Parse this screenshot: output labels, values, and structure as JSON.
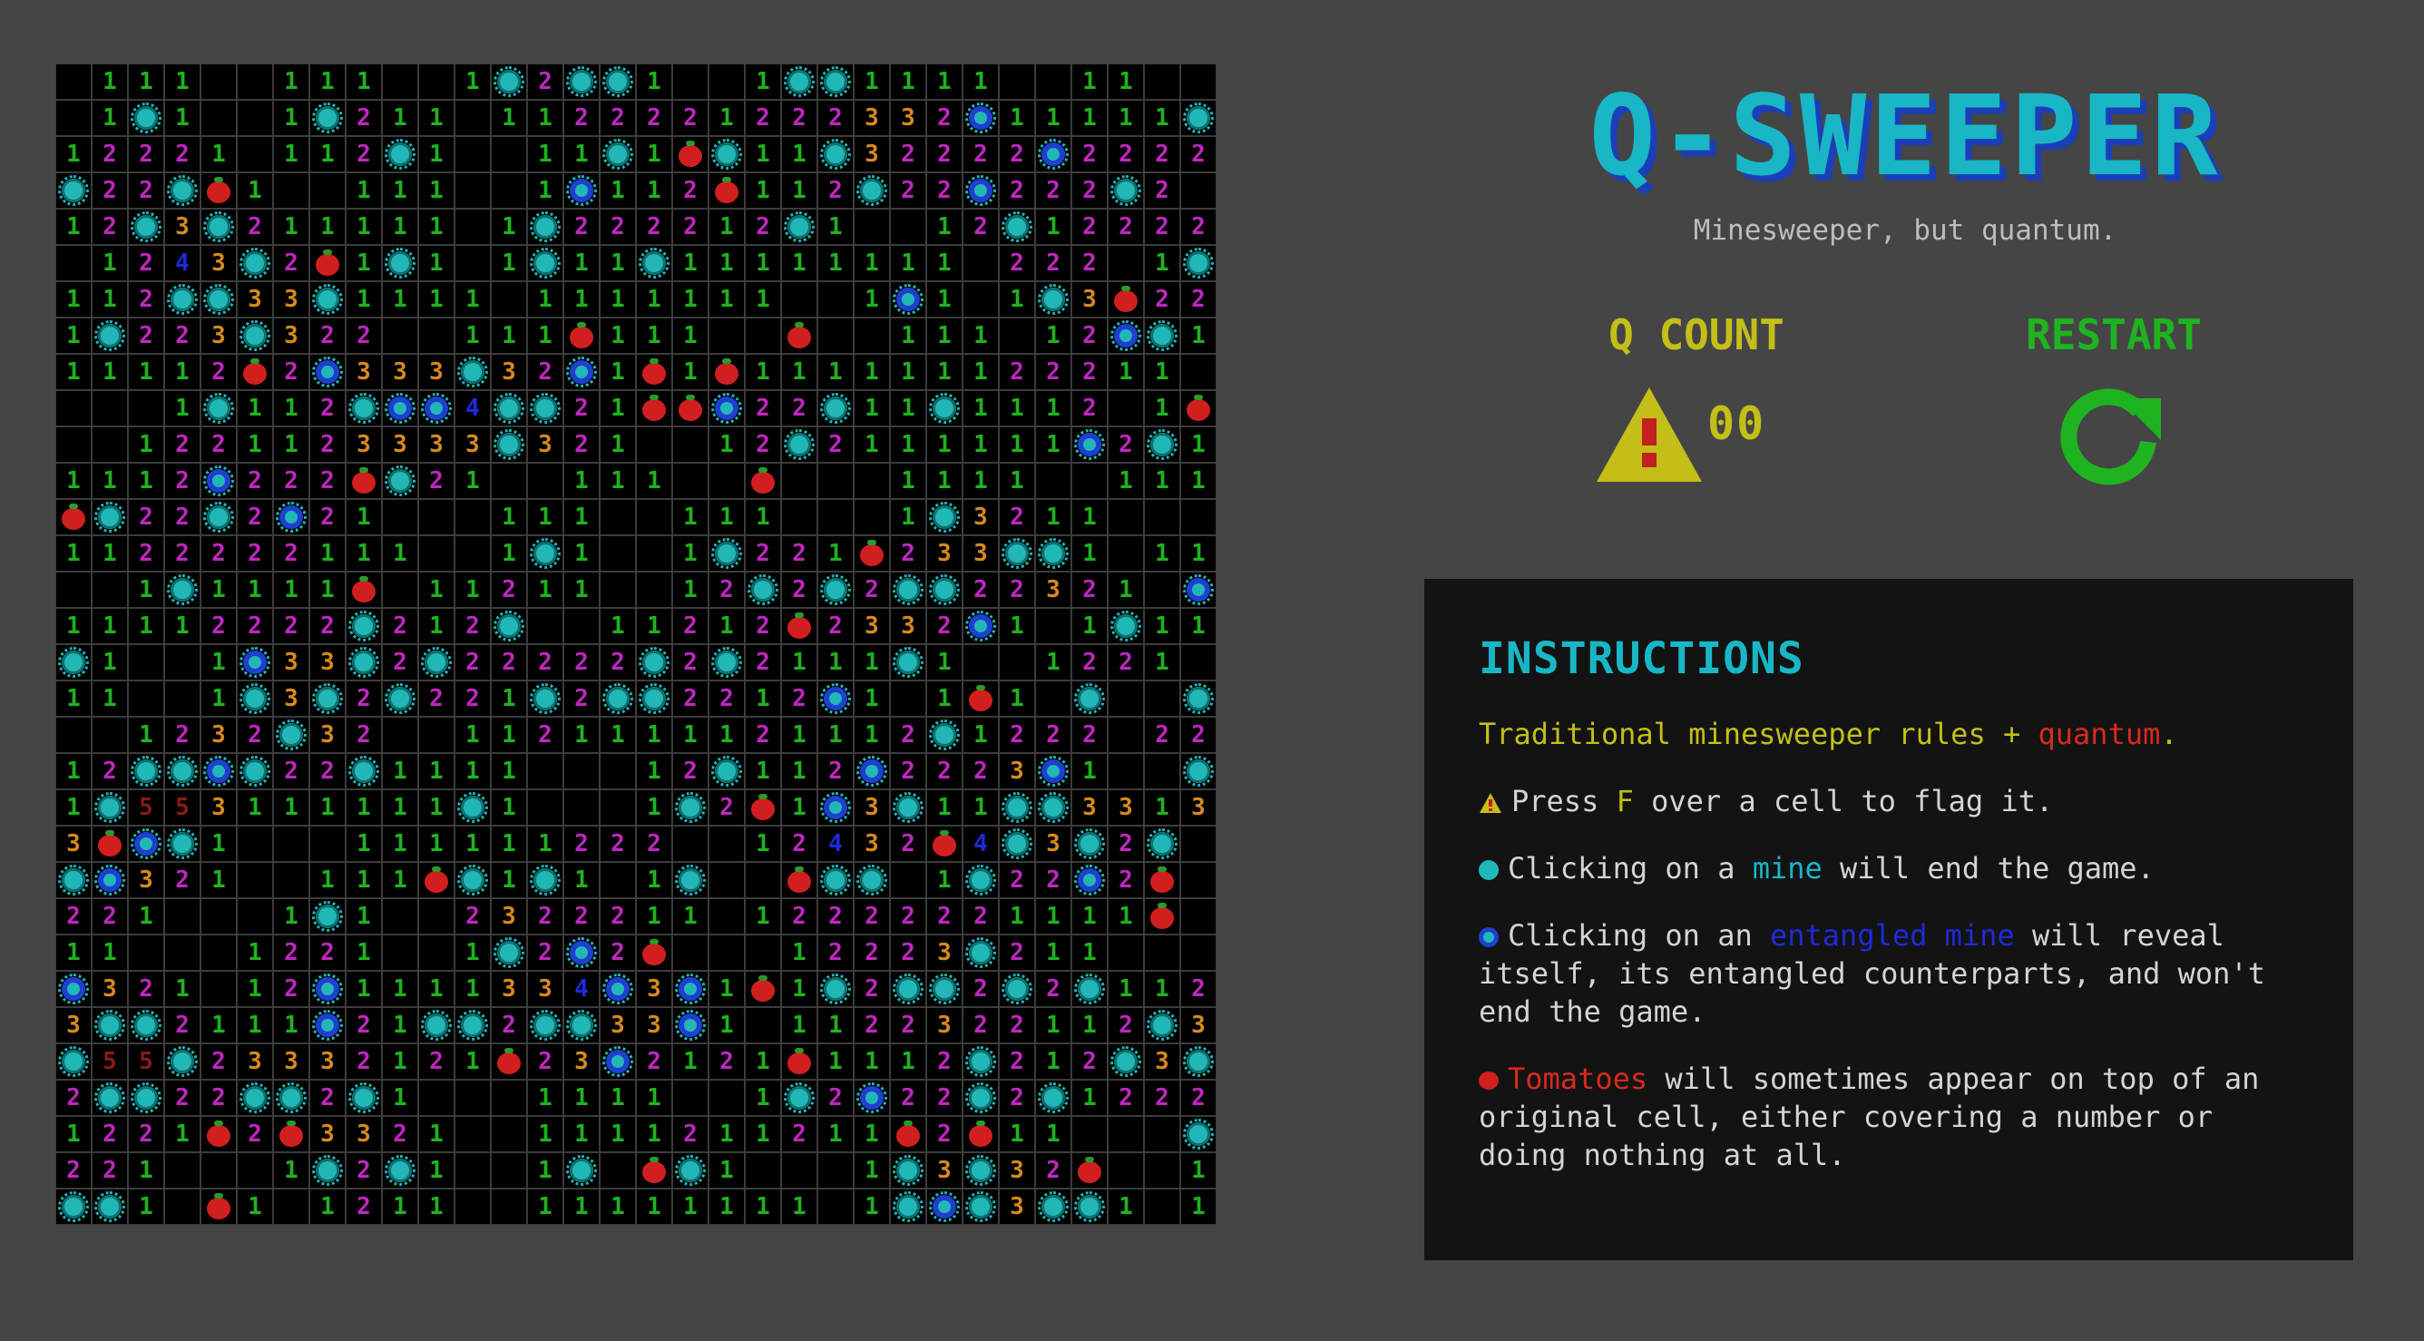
{
  "header": {
    "title": "Q-SWEEPER",
    "subtitle": "Minesweeper, but quantum."
  },
  "status": {
    "qcount_label": "Q COUNT",
    "qcount_value": "00",
    "qcount_icon": "warning-flag-icon",
    "restart_label": "RESTART",
    "restart_icon": "restart-arrow-icon"
  },
  "instructions": {
    "heading": "INSTRUCTIONS",
    "line1": {
      "pre": "Traditional minesweeper rules + ",
      "highlight": "quantum",
      "post": "."
    },
    "line2": {
      "pre": "Press ",
      "key": "F",
      "post": " over a cell to flag it."
    },
    "line3": {
      "pre": "Clicking on a ",
      "highlight": "mine",
      "post": " will end the game."
    },
    "line4": {
      "pre": "Clicking on an ",
      "highlight": "entangled mine",
      "post": " will reveal itself, its entangled counterparts, and won't end the game."
    },
    "line5": {
      "highlight": "Tomatoes",
      "post": " will sometimes appear on top of an original cell, either covering a number or doing nothing at all."
    }
  },
  "colors": {
    "background": "#454545",
    "cell": "#000000",
    "title": "#19b6c6",
    "title_shadow": "#1b3fb8",
    "qcount": "#c3bf18",
    "restart": "#1fb31f",
    "num1": "#1fb31f",
    "num2": "#c026c0",
    "num3": "#d68a1c",
    "num4": "#1e2ad8",
    "num5": "#8a1a1a",
    "mine": "#22b7b7",
    "entangled_mine": "#1e3fd0",
    "tomato": "#d11f1f"
  },
  "board": {
    "cols": 32,
    "legend": {
      ".": "empty",
      "M": "mine",
      "E": "entangled-mine",
      "T": "tomato"
    },
    "rows": [
      ".111..111..1M2MM1..1MM1111..11..",
      ".1M1..1M211.1122221222332E11111M",
      "12221.112M1..11M1TM11M32222E2222",
      "M22MT1..111..1E112T112M22E222M2.",
      "12M3M211111.1M222212M1..12M12222",
      ".1243M2T1M1.1M11M11111111.222.1M",
      "112MM33M1111.1111111..1E1.1M3T22",
      "1M223M322..111T111..T..111.12EM11",
      "11112T2E333M32E1T1T111111122211",
      "...1M112MEE4MM21TTE22M11M1112.1T",
      "..1221123333M321..12M2111111E2M1",
      "1112E222TM21..111..T...1111..111",
      "TM22M2E21...111..111...1M3211...",
      "1122222111..1M1..1M221T233MM1.11",
      "..1M1111T.11211..12M2M2MM22321.E",
      "11112222M212M..11212T2332E1.1M111",
      "M1..1E33M2M22222M2M2111M1..1221",
      "11..1M3M2M221M2MM2212E1.1T1.M..M",
      "..1232M32..1121111121112M1222.22",
      "12MMEM22M1111...12M112E2223E1..M",
      "1M553111111M1...1M2T1E3M11MM3313",
      "3TEM1...111111222..12432T4M3M2M",
      "ME321..111TM1M1.1M..TMM.1M22E2T",
      "221...1M1..2322211.12222221111T",
      "11...1221..1M2E2T...12223M211...",
      "E321.12E1111334E3E1T1M2MM2M2M112M",
      "3MM2111E21MM2MM33E1.1122322112M32",
      "M55M23332121T23E2121T1112M212M3M1",
      "2MM22MM2M1...1111..1M2E22M2M1222",
      "1221T2T3321..1111211211T2T11...M",
      "221...1M2M1..1M.TM1...1M3M32T..133",
      "MM1.T1.1211..11111111.1MEM3MM1.1MM"
    ]
  }
}
